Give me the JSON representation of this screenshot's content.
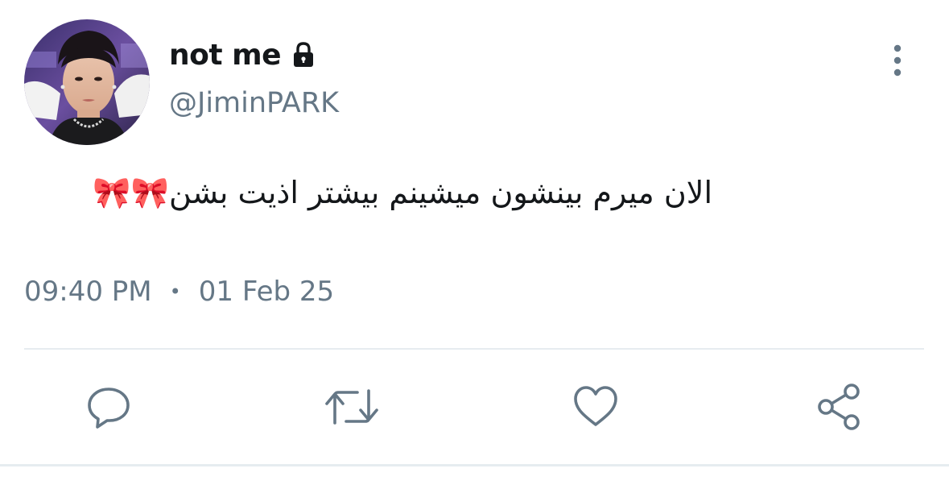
{
  "user": {
    "display_name": "not me",
    "handle": "@JiminPARK",
    "avatar_icon": "profile-photo",
    "lock_icon": "lock-icon"
  },
  "tweet": {
    "text": "الان میرم بینشون میشینم بیشتر اذیت بشن🎀🎀",
    "time": "09:40 PM",
    "separator": "•",
    "date": "01 Feb 25"
  },
  "actions": [
    {
      "name": "reply",
      "icon": "reply-icon"
    },
    {
      "name": "retweet",
      "icon": "retweet-icon"
    },
    {
      "name": "like",
      "icon": "heart-icon"
    },
    {
      "name": "share",
      "icon": "share-icon"
    }
  ],
  "colors": {
    "text_primary": "#14171a",
    "text_secondary": "#657786",
    "icon": "#657786",
    "divider": "#e6ecf0"
  }
}
